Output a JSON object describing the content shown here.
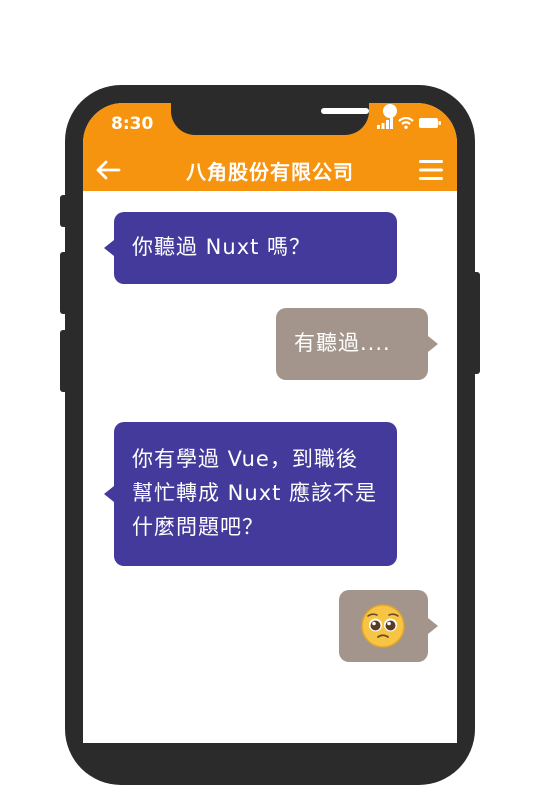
{
  "status_bar": {
    "time": "8:30"
  },
  "header": {
    "title": "八角股份有限公司"
  },
  "messages": [
    {
      "side": "left",
      "text": "你聽過 Nuxt 嗎？"
    },
    {
      "side": "right",
      "text": "有聽過...."
    },
    {
      "side": "left",
      "text": "你有學過 Vue，到職後幫忙轉成 Nuxt 應該不是什麼問題吧？"
    },
    {
      "side": "right",
      "emoji": "pleading-face"
    }
  ],
  "colors": {
    "header": "#f7940f",
    "bubble_left": "#443a9b",
    "bubble_right": "#a3958b",
    "phone_frame": "#2b2b2b"
  }
}
